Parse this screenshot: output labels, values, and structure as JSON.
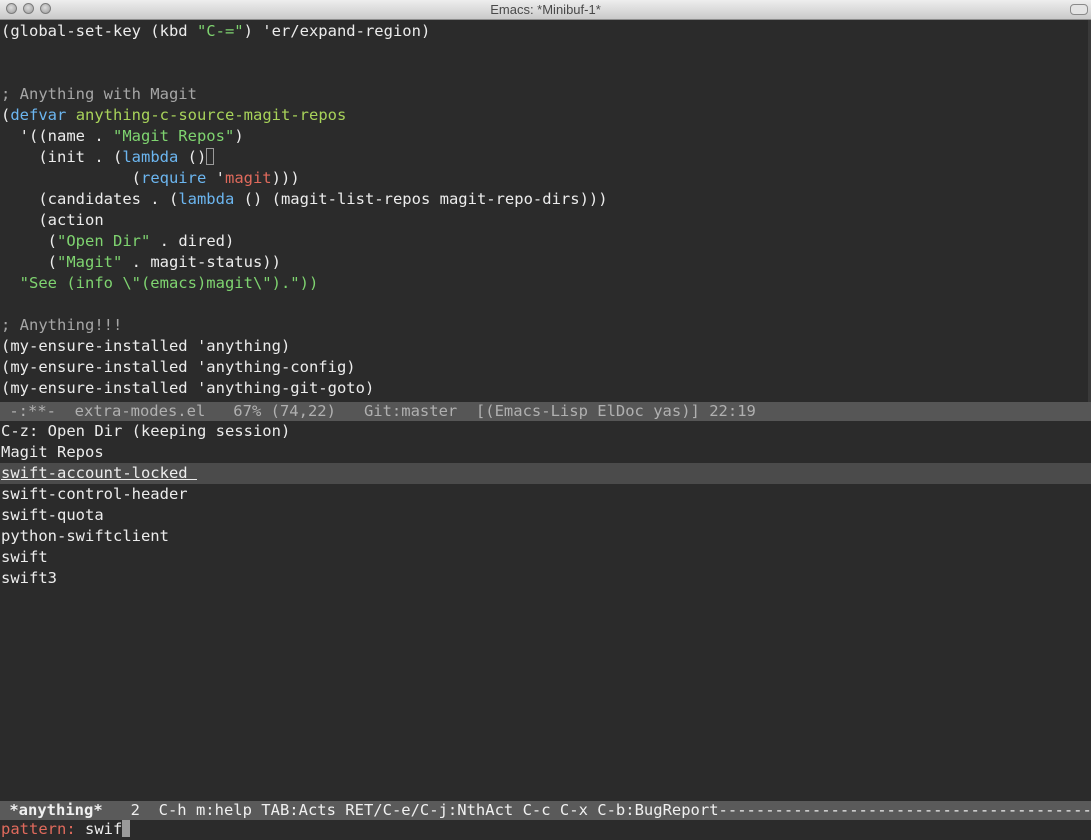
{
  "window": {
    "title": "Emacs:  *Minibuf-1*"
  },
  "code": {
    "l1_a": "(global-set-key (kbd ",
    "l1_b": "\"C-=\"",
    "l1_c": ") 'er/expand-region)",
    "l4": "; Anything with Magit",
    "l5_a": "(",
    "l5_b": "defvar",
    "l5_c": " ",
    "l5_d": "anything-c-source-magit-repos",
    "l6_a": "  '((name . ",
    "l6_b": "\"Magit Repos\"",
    "l6_c": ")",
    "l7_a": "    (init . (",
    "l7_b": "lambda",
    "l7_c": " ()",
    "l8_a": "              (",
    "l8_b": "require",
    "l8_c": " '",
    "l8_d": "magit",
    "l8_e": ")))",
    "l9_a": "    (candidates . (",
    "l9_b": "lambda",
    "l9_c": " () (magit-list-repos magit-repo-dirs)))",
    "l10": "    (action",
    "l11_a": "     (",
    "l11_b": "\"Open Dir\"",
    "l11_c": " . dired)",
    "l12_a": "     (",
    "l12_b": "\"Magit\"",
    "l12_c": " . magit-status))",
    "l13": "  \"See (info \\\"(emacs)magit\\\").\"))",
    "l15": "; Anything!!!",
    "l16": "(my-ensure-installed 'anything)",
    "l17": "(my-ensure-installed 'anything-config)",
    "l18": "(my-ensure-installed 'anything-git-goto)"
  },
  "modeline": {
    "text": " -:**-  extra-modes.el   67% (74,22)   Git:master  [(Emacs-Lisp ElDoc yas)] 22:19"
  },
  "anything": {
    "header": "C-z: Open Dir (keeping session)",
    "source": "Magit Repos",
    "items": [
      "swift-account-locked ",
      "swift-control-header",
      "swift-quota",
      "python-swiftclient",
      "swift",
      "swift3"
    ]
  },
  "anything_modeline": {
    "buffer": " *anything*",
    "rest": "   2  C-h m:help TAB:Acts RET/C-e/C-j:NthAct C-c C-x C-b:BugReport-----------------------------------------------------------------"
  },
  "minibuffer": {
    "prompt": "pattern: ",
    "value": "swif"
  }
}
